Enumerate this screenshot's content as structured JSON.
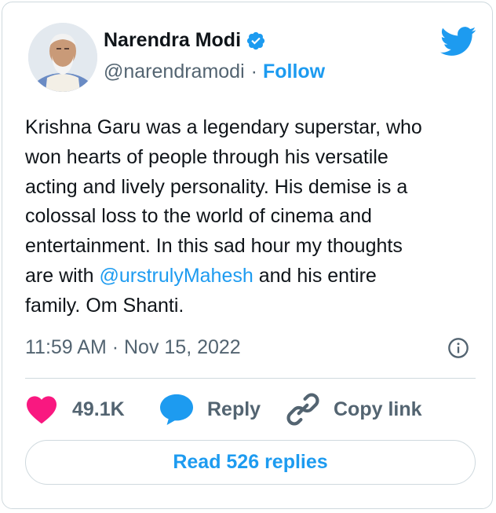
{
  "author": {
    "name": "Narendra Modi",
    "handle": "@narendramodi",
    "separator": "·",
    "follow_label": "Follow"
  },
  "tweet": {
    "text_before_mention": "Krishna Garu was a legendary superstar, who\nwon hearts of people through his versatile\nacting and lively personality. His demise is a\ncolossal loss to the world of cinema and\nentertainment. In this sad hour my thoughts\nare with ",
    "mention": "@urstrulyMahesh",
    "text_after_mention": " and his entire\nfamily. Om Shanti.",
    "timestamp": "11:59 AM · Nov 15, 2022"
  },
  "actions": {
    "like_count": "49.1K",
    "reply_label": "Reply",
    "copy_link_label": "Copy link"
  },
  "read_replies_label": "Read 526 replies",
  "icons": {
    "verified": "verified-badge-icon",
    "twitter": "twitter-bird-icon",
    "info": "info-icon",
    "like": "heart-icon",
    "reply": "speech-bubble-icon",
    "copy": "link-icon"
  },
  "colors": {
    "accent": "#1d9bf0",
    "like": "#f91880",
    "secondary_text": "#536471",
    "border": "#cfd9de"
  }
}
